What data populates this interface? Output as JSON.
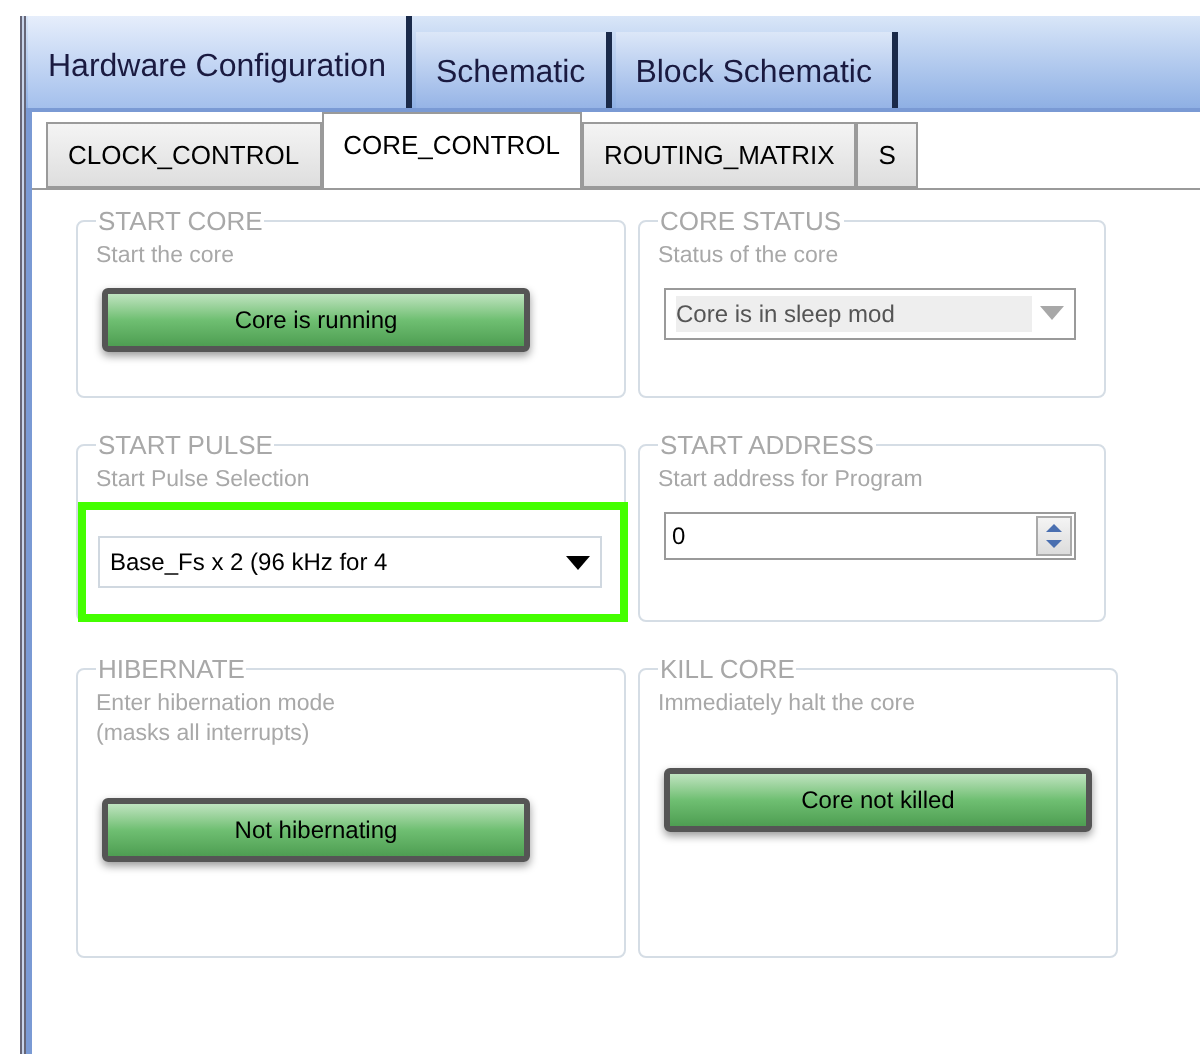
{
  "tabs": [
    {
      "label": "Hardware Configuration",
      "selected": true
    },
    {
      "label": "Schematic",
      "selected": false
    },
    {
      "label": "Block Schematic",
      "selected": false
    }
  ],
  "subtabs": [
    {
      "label": "CLOCK_CONTROL",
      "selected": false
    },
    {
      "label": "CORE_CONTROL",
      "selected": true
    },
    {
      "label": "ROUTING_MATRIX",
      "selected": false
    },
    {
      "label": "S",
      "selected": false
    }
  ],
  "panels": [
    {
      "title": "START CORE",
      "description": "Start the core",
      "kind": "button",
      "value": "Core is running",
      "highlighted": false
    },
    {
      "title": "CORE STATUS",
      "description": "Status of the core",
      "kind": "dropdown",
      "value": "Core is in sleep mod",
      "disabled": true,
      "highlighted": false
    },
    {
      "title": "START PULSE",
      "description": "Start Pulse Selection",
      "kind": "dropdown",
      "value": "Base_Fs x 2 (96 kHz for 4",
      "disabled": false,
      "highlighted": true
    },
    {
      "title": "START ADDRESS",
      "description": "Start address for Program",
      "kind": "spinner",
      "value": "0",
      "highlighted": false
    },
    {
      "title": "HIBERNATE",
      "description": "Enter hibernation mode\n(masks all interrupts)",
      "kind": "button",
      "value": "Not hibernating",
      "highlighted": false
    },
    {
      "title": "KILL CORE",
      "description": "Immediately halt the core",
      "kind": "button",
      "value": "Core not killed",
      "highlighted": false
    }
  ]
}
